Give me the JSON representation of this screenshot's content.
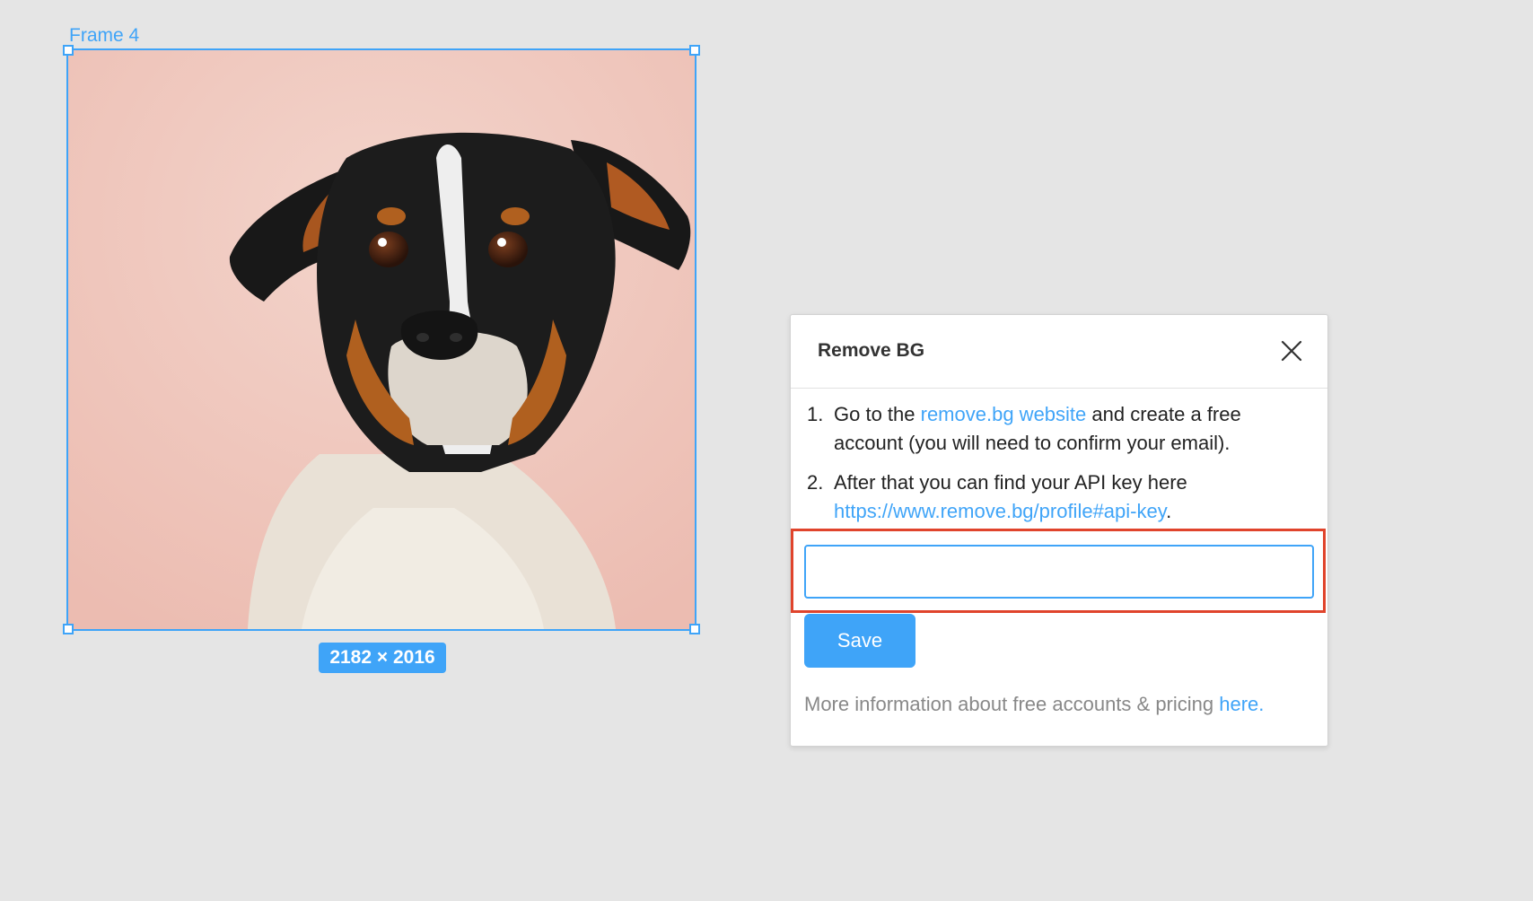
{
  "canvas": {
    "frame_label": "Frame 4",
    "size_badge": "2182 × 2016",
    "image_subject": "dog-portrait"
  },
  "dialog": {
    "title": "Remove BG",
    "steps": [
      {
        "number": "1.",
        "before_link": "Go to the ",
        "link_text": "remove.bg website",
        "after_link": " and create a free account (you will need to confirm your email)."
      },
      {
        "number": "2.",
        "before_link": "After that you can find your API key here ",
        "link_text": "https://www.remove.bg/profile#api-key",
        "after_link": "."
      }
    ],
    "api_key_input": {
      "value": "",
      "placeholder": ""
    },
    "save_label": "Save",
    "footer": {
      "text": "More information about free accounts & pricing ",
      "link_text": "here",
      "after_link": "."
    }
  },
  "colors": {
    "accent": "#3fa4f8",
    "highlight": "#e0442c",
    "canvas_bg": "#e5e5e5"
  },
  "icons": {
    "close": "close-icon"
  }
}
